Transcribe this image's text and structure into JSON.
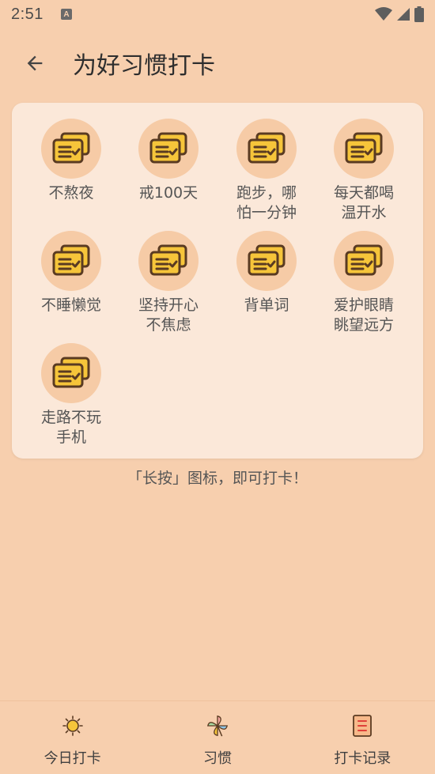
{
  "status_bar": {
    "time": "2:51",
    "notif_letter": "A"
  },
  "app_bar": {
    "title": "为好习惯打卡"
  },
  "habits": [
    {
      "label": "不熬夜"
    },
    {
      "label": "戒100天"
    },
    {
      "label": "跑步，哪怕一分钟"
    },
    {
      "label": "每天都喝温开水"
    },
    {
      "label": "不睡懒觉"
    },
    {
      "label": "坚持开心不焦虑"
    },
    {
      "label": "背单词"
    },
    {
      "label": "爱护眼睛眺望远方"
    },
    {
      "label": "走路不玩手机"
    }
  ],
  "hint": "「长按」图标，即可打卡！",
  "bottom_nav": {
    "items": [
      {
        "label": "今日打卡",
        "icon": "sun-icon"
      },
      {
        "label": "习惯",
        "icon": "pinwheel-icon"
      },
      {
        "label": "打卡记录",
        "icon": "record-icon"
      }
    ]
  },
  "colors": {
    "background": "#f7cfae",
    "card": "#fbe8d9",
    "icon_circle": "#f6cba6",
    "icon_yellow": "#f6c53a",
    "icon_brown": "#5a3b22"
  }
}
